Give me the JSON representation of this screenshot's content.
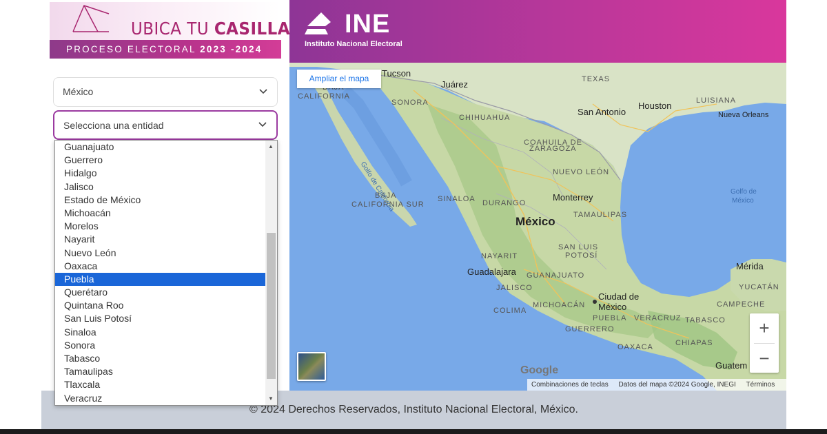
{
  "brand": {
    "title_light": "UBICA TU ",
    "title_bold": "CASILLA",
    "subtitle": "PROCESO ELECTORAL ",
    "years": "2023 -2024",
    "ine_name": "INE",
    "ine_full": "Instituto Nacional Electoral"
  },
  "selects": {
    "country_value": "México",
    "entity_placeholder": "Selecciona una entidad"
  },
  "dropdown": {
    "options": [
      "Guanajuato",
      "Guerrero",
      "Hidalgo",
      "Jalisco",
      "Estado de México",
      "Michoacán",
      "Morelos",
      "Nayarit",
      "Nuevo León",
      "Oaxaca",
      "Puebla",
      "Querétaro",
      "Quintana Roo",
      "San Luis Potosí",
      "Sinaloa",
      "Sonora",
      "Tabasco",
      "Tamaulipas",
      "Tlaxcala",
      "Veracruz"
    ],
    "selected": "Puebla"
  },
  "map": {
    "expand_label": "Ampliar el mapa",
    "cities": [
      "Tucson",
      "Juárez",
      "San Antonio",
      "Houston",
      "Nueva Orleans",
      "Monterrey",
      "México",
      "Guadalajara",
      "Ciudad de",
      "México",
      "Mérida",
      "Guatem"
    ],
    "regions": [
      "TEXAS",
      "LUISIANA",
      "BAJA",
      "CALIFORNIA",
      "SONORA",
      "CHIHUAHUA",
      "COAHUILA DE",
      "ZARAGOZA",
      "NUEVO LEÓN",
      "BAJA",
      "CALIFORNIA SUR",
      "SINALOA",
      "DURANGO",
      "TAMAULIPAS",
      "SAN LUIS",
      "POTOSÍ",
      "NAYARIT",
      "GUANAJUATO",
      "JALISCO",
      "MICHOACÁN",
      "COLIMA",
      "PUEBLA",
      "VERACRUZ",
      "GUERRERO",
      "OAXACA",
      "TABASCO",
      "CHIAPAS",
      "CAMPECHE",
      "YUCATÁN"
    ],
    "water": [
      "Golfo de California",
      "Golfo de",
      "México"
    ],
    "zoom_in": "+",
    "zoom_out": "−",
    "google": "Google",
    "attribution": [
      "Combinaciones de teclas",
      "Datos del mapa ©2024 Google, INEGI",
      "Términos"
    ]
  },
  "footer": {
    "text": "© 2024 Derechos Reservados, Instituto Nacional Electoral, México."
  },
  "colors": {
    "brand_magenta": "#b9379a",
    "brand_purple": "#8e3596",
    "selected_blue": "#1a66d8",
    "footer_bg": "#c9cfd9"
  }
}
